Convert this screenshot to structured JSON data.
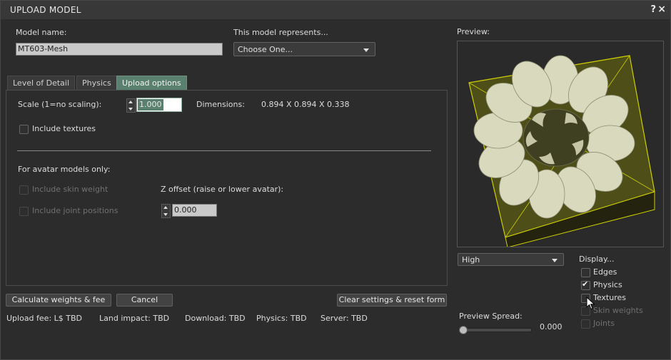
{
  "window": {
    "title": "UPLOAD MODEL",
    "help_glyph": "?",
    "close_glyph": "×"
  },
  "model_name": {
    "label": "Model name:",
    "value": "MT603-Mesh"
  },
  "represents": {
    "label": "This model represents...",
    "selected": "Choose One..."
  },
  "tabs": [
    {
      "label": "Level of Detail",
      "active": false
    },
    {
      "label": "Physics",
      "active": false
    },
    {
      "label": "Upload options",
      "active": true
    }
  ],
  "upload_options": {
    "scale_label": "Scale (1=no scaling):",
    "scale_value": "1.000",
    "dimensions_label": "Dimensions:",
    "dimensions_value": "0.894 X 0.894 X 0.338",
    "include_textures": "Include textures",
    "avatar_header": "For avatar models only:",
    "include_skin_weight": "Include skin weight",
    "include_joint_positions": "Include joint positions",
    "z_offset_label": "Z offset (raise or lower avatar):",
    "z_offset_value": "0.000"
  },
  "buttons": {
    "calculate": "Calculate weights & fee",
    "cancel": "Cancel",
    "clear": "Clear settings & reset form"
  },
  "status": {
    "upload_fee": "Upload fee: L$ TBD",
    "land_impact": "Land impact: TBD",
    "download": "Download: TBD",
    "physics": "Physics: TBD",
    "server": "Server: TBD"
  },
  "preview": {
    "label": "Preview:",
    "lod_selected": "High",
    "display_label": "Display...",
    "display_options": [
      {
        "label": "Edges",
        "checked": false,
        "enabled": true
      },
      {
        "label": "Physics",
        "checked": true,
        "enabled": true
      },
      {
        "label": "Textures",
        "checked": false,
        "enabled": true
      },
      {
        "label": "Skin weights",
        "checked": false,
        "enabled": false
      },
      {
        "label": "Joints",
        "checked": false,
        "enabled": false
      }
    ],
    "spread_label": "Preview Spread:",
    "spread_value": "0.000"
  },
  "colors": {
    "active_tab": "#5a8070",
    "preview_bbox": "#d8d800",
    "mesh": "#d8d8be"
  }
}
